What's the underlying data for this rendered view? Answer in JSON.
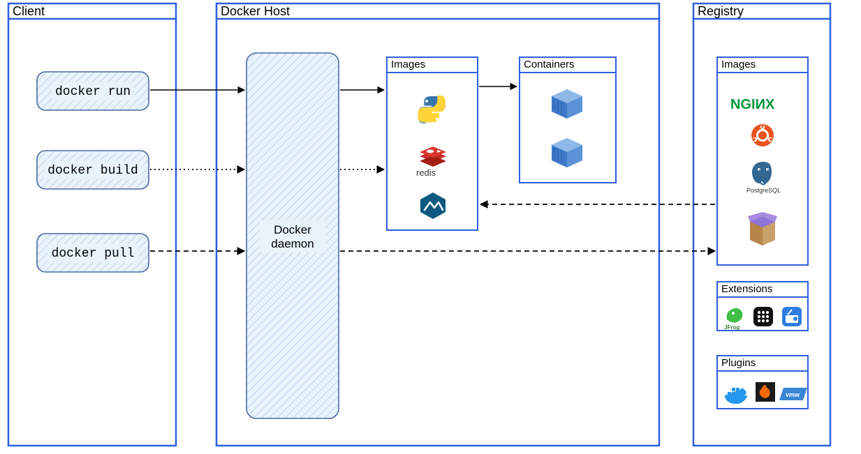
{
  "client": {
    "title": "Client",
    "commands": {
      "run": "docker run",
      "build": "docker build",
      "pull": "docker pull"
    }
  },
  "host": {
    "title": "Docker Host",
    "daemon_label": "Docker daemon",
    "images_title": "Images",
    "containers_title": "Containers",
    "image_icons": [
      "python-icon",
      "redis-icon",
      "alpine-icon"
    ],
    "container_icons": [
      "container-icon",
      "container-icon"
    ]
  },
  "registry": {
    "title": "Registry",
    "images_title": "Images",
    "extensions_title": "Extensions",
    "plugins_title": "Plugins",
    "image_icons": [
      "nginx-icon",
      "ubuntu-icon",
      "postgresql-icon",
      "box-icon"
    ],
    "extension_icons": [
      "jfrog-icon",
      "grid-app-icon",
      "radio-icon"
    ],
    "plugin_icons": [
      "docker-whale-icon",
      "grafana-icon",
      "vmware-icon"
    ]
  },
  "colors": {
    "panel_border": "#2D5FE0",
    "cmd_fill": "#e9f3fb",
    "cmd_stroke": "#4a6aa3",
    "daemon_fill": "#e9f3fb",
    "container_blue": "#3e78c9",
    "nginx_green": "#009639",
    "ubuntu_orange": "#e95420",
    "postgres_blue": "#336791",
    "redis_red": "#c6302b",
    "python_blue": "#3776ab",
    "python_yellow": "#ffd43b",
    "alpine_blue": "#0d597f",
    "docker_blue": "#2496ed",
    "grafana_orange": "#f46800",
    "vmware_blue": "#3a86d6",
    "jfrog_green": "#40be46",
    "box_purple": "#8e74d4",
    "radio_blue": "#2f7de1"
  }
}
